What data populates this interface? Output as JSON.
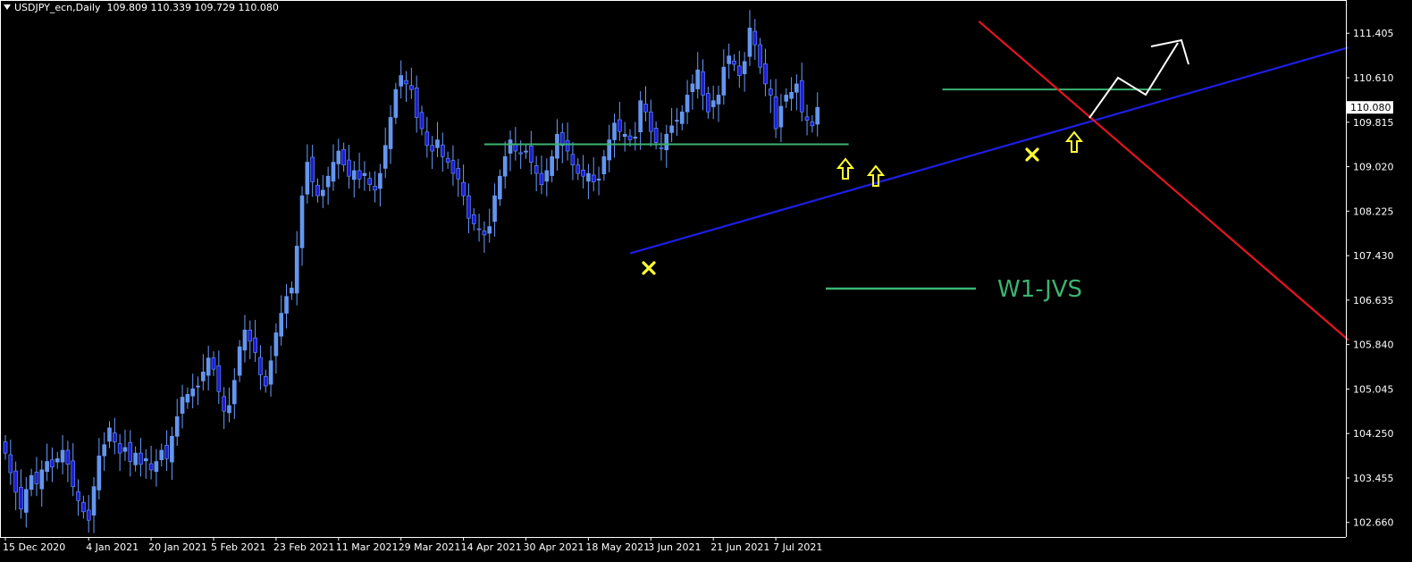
{
  "header": {
    "symbol_info": "USDJPY_ecn,Daily",
    "ohlc": "109.809 110.339 109.729 110.080"
  },
  "colors": {
    "background": "#000000",
    "axis": "#ffffff",
    "bull_body": "#6495ed",
    "bear_body": "#1d1dd6",
    "wick": "#6b9cff",
    "support_line": "#3cb371",
    "trend_line": "#1e1ee6",
    "resistance_line": "#e6141e",
    "projection": "#ffffff",
    "marker": "#ffff33",
    "price_tag_bg": "#ffffff",
    "price_tag_text": "#000000"
  },
  "legend_text": "W1-JVS",
  "chart_data": {
    "type": "candlestick",
    "ylim": [
      102.4,
      112.0
    ],
    "ytick_labels": [
      "111.405",
      "110.610",
      "109.815",
      "109.020",
      "108.225",
      "107.430",
      "106.635",
      "105.840",
      "105.045",
      "104.250",
      "103.455",
      "102.660"
    ],
    "yticks": [
      111.405,
      110.61,
      109.815,
      109.02,
      108.225,
      107.43,
      106.635,
      105.84,
      105.045,
      104.25,
      103.455,
      102.66
    ],
    "xtick_labels": [
      "15 Dec 2020",
      "4 Jan 2021",
      "20 Jan 2021",
      "5 Feb 2021",
      "23 Feb 2021",
      "11 Mar 2021",
      "29 Mar 2021",
      "14 Apr 2021",
      "30 Apr 2021",
      "18 May 2021",
      "3 Jun 2021",
      "21 Jun 2021",
      "7 Jul 2021"
    ],
    "xtick_index": [
      0,
      16,
      28,
      40,
      52,
      64,
      76,
      88,
      100,
      112,
      124,
      136,
      148
    ],
    "current_price": "110.080",
    "closes": [
      103.9,
      103.55,
      103.2,
      102.9,
      103.25,
      103.5,
      103.35,
      103.6,
      103.75,
      103.65,
      103.8,
      103.95,
      103.7,
      103.3,
      103.05,
      102.85,
      102.7,
      103.3,
      103.85,
      104.05,
      104.35,
      104.1,
      103.9,
      104.0,
      103.75,
      103.9,
      103.7,
      103.8,
      103.6,
      103.75,
      103.95,
      103.8,
      104.2,
      104.55,
      104.9,
      104.95,
      105.05,
      105.1,
      105.35,
      105.6,
      105.4,
      105.0,
      104.65,
      104.75,
      105.2,
      105.8,
      106.1,
      105.9,
      105.7,
      105.3,
      105.1,
      105.55,
      106.05,
      106.4,
      106.7,
      106.85,
      107.6,
      108.5,
      109.1,
      108.75,
      108.5,
      108.6,
      108.85,
      109.1,
      109.3,
      109.05,
      108.85,
      108.95,
      108.8,
      108.9,
      108.7,
      108.6,
      108.9,
      109.4,
      109.9,
      110.4,
      110.65,
      110.5,
      110.4,
      109.9,
      109.7,
      109.4,
      109.3,
      109.5,
      109.2,
      109.1,
      108.9,
      108.8,
      108.5,
      108.1,
      108.0,
      107.9,
      107.8,
      107.95,
      108.5,
      108.85,
      109.2,
      109.5,
      109.3,
      109.25,
      109.3,
      109.1,
      108.9,
      108.7,
      108.95,
      109.2,
      109.6,
      109.4,
      109.3,
      109.05,
      108.9,
      108.85,
      108.9,
      108.75,
      108.8,
      109.2,
      109.5,
      109.8,
      109.65,
      109.6,
      109.5,
      109.55,
      110.2,
      110.0,
      109.65,
      109.45,
      109.35,
      109.6,
      109.75,
      109.85,
      110.0,
      110.3,
      110.5,
      110.75,
      110.3,
      110.0,
      110.2,
      110.3,
      110.8,
      111.0,
      110.85,
      110.65,
      110.9,
      111.5,
      111.2,
      110.8,
      110.5,
      110.3,
      109.7,
      110.1,
      110.3,
      110.35,
      110.5,
      110.0,
      109.85,
      109.75,
      110.08
    ],
    "trendline_blue_from": [
      120,
      107.47
    ],
    "trendline_blue_to": [
      258,
      111.15
    ],
    "trendline_red_from": [
      187,
      111.62
    ],
    "trendline_red_to": [
      258,
      105.92
    ],
    "support_h1": {
      "price": 109.42,
      "from": 92,
      "to": 162
    },
    "support_h2": {
      "price": 110.4,
      "from": 180,
      "to": 222
    }
  }
}
